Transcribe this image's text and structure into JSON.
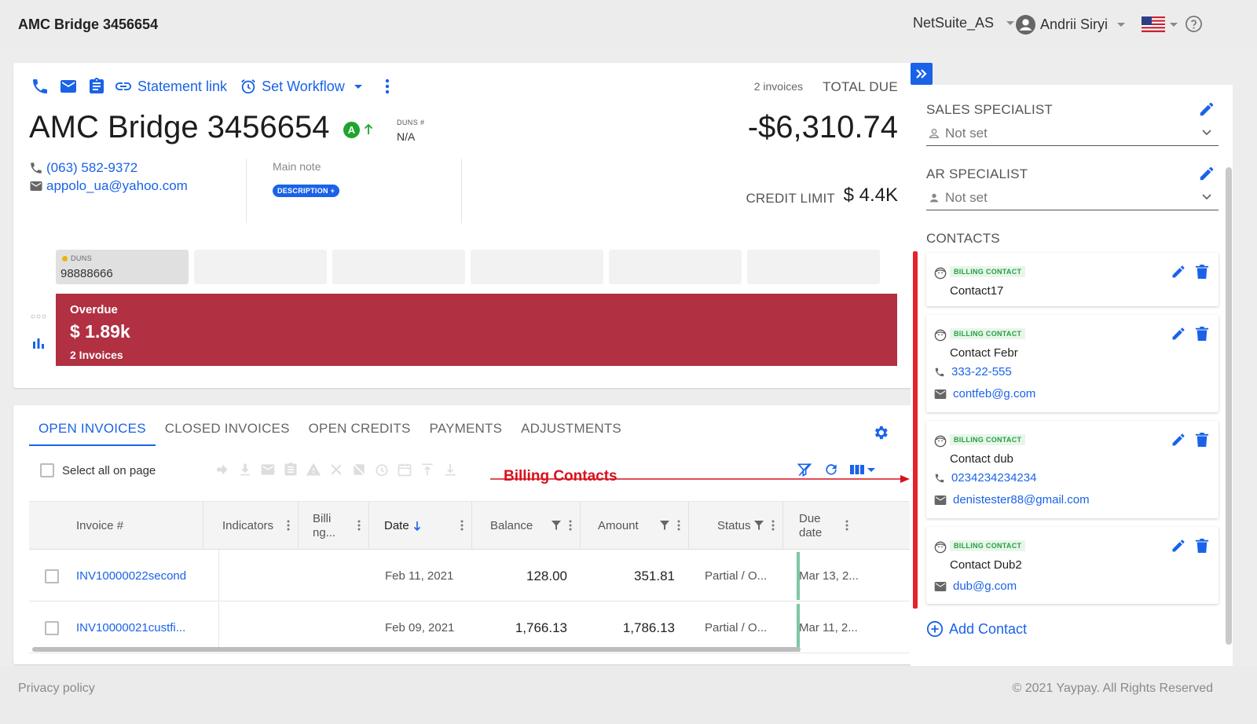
{
  "topbar": {
    "title": "AMC Bridge 3456654",
    "account": "NetSuite_AS",
    "user": "Andrii Siryi"
  },
  "toolbar": {
    "statement_link": "Statement link",
    "set_workflow": "Set Workflow"
  },
  "customer": {
    "name": "AMC Bridge 3456654",
    "rating": "A",
    "duns_label": "DUNS #",
    "duns_value": "N/A",
    "phone": "(063) 582-9372",
    "email": "appolo_ua@yahoo.com",
    "main_note_label": "Main note",
    "description_badge": "DESCRIPTION +"
  },
  "summary": {
    "invoice_count": "2 invoices",
    "total_due_label": "TOTAL DUE",
    "total_due": "-$6,310.74",
    "credit_limit_label": "CREDIT LIMIT",
    "credit_limit": "$ 4.4K"
  },
  "duns_tile": {
    "label": "DUNS",
    "value": "98888666"
  },
  "overdue": {
    "label": "Overdue",
    "amount": "$ 1.89k",
    "count": "2 Invoices"
  },
  "tabs": [
    {
      "label": "OPEN INVOICES",
      "active": true
    },
    {
      "label": "CLOSED INVOICES"
    },
    {
      "label": "OPEN CREDITS"
    },
    {
      "label": "PAYMENTS"
    },
    {
      "label": "ADJUSTMENTS"
    }
  ],
  "table": {
    "select_all": "Select all on page",
    "columns": {
      "invoice": "Invoice #",
      "indicators": "Indicators",
      "billing_1": "Billi",
      "billing_2": "ng...",
      "date": "Date",
      "balance": "Balance",
      "amount": "Amount",
      "status": "Status",
      "due_1": "Due",
      "due_2": "date"
    },
    "rows": [
      {
        "invoice": "INV10000022second",
        "date": "Feb 11, 2021",
        "balance": "128.00",
        "amount": "351.81",
        "status": "Partial / O...",
        "due": "Mar 13, 2..."
      },
      {
        "invoice": "INV10000021custfi...",
        "date": "Feb 09, 2021",
        "balance": "1,766.13",
        "amount": "1,786.13",
        "status": "Partial / O...",
        "due": "Mar 11, 2..."
      }
    ]
  },
  "annotation": {
    "text": "Billing Contacts",
    "color": "#d6121c"
  },
  "right_panel": {
    "sales_specialist_label": "SALES SPECIALIST",
    "sales_specialist_value": "Not set",
    "ar_specialist_label": "AR SPECIALIST",
    "ar_specialist_value": "Not set",
    "contacts_label": "CONTACTS",
    "contacts": [
      {
        "badge": "BILLING CONTACT",
        "name": "Contact17"
      },
      {
        "badge": "BILLING CONTACT",
        "name": "Contact Febr",
        "phone": "333-22-555",
        "email": "contfeb@g.com"
      },
      {
        "badge": "BILLING CONTACT",
        "name": "Contact dub",
        "phone": "0234234234234",
        "email": "denistester88@gmail.com"
      },
      {
        "badge": "BILLING CONTACT",
        "name": "Contact Dub2",
        "email": "dub@g.com"
      }
    ],
    "add_contact": "Add Contact"
  },
  "footer": {
    "privacy": "Privacy policy",
    "copyright": "© 2021 Yaypay. All Rights Reserved"
  },
  "colors": {
    "accent": "#1a63e8",
    "overdue": "#b13041",
    "badge_green": "#24a042",
    "annotation_red": "#e8222c"
  }
}
